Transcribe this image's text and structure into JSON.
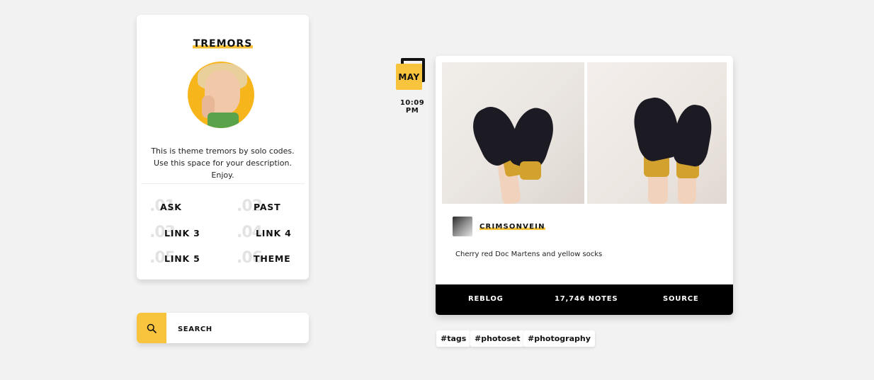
{
  "sidebar": {
    "blog_title": "TREMORS",
    "description": "This is theme tremors by solo codes. Use this space for your description. Enjoy.",
    "links": [
      {
        "num": ".01",
        "label": "ASK"
      },
      {
        "num": ".02",
        "label": "PAST"
      },
      {
        "num": ".03",
        "label": "LINK 3"
      },
      {
        "num": ".04",
        "label": "LINK 4"
      },
      {
        "num": ".05",
        "label": "LINK 5"
      },
      {
        "num": ".06",
        "label": "THEME"
      }
    ]
  },
  "search": {
    "placeholder": "SEARCH",
    "icon": "search-icon"
  },
  "post": {
    "month": "MAY",
    "time": "10:09 PM",
    "poster_name": "CRIMSONVEIN",
    "caption": "Cherry red Doc Martens and yellow socks",
    "footer": {
      "reblog": "REBLOG",
      "notes": "17,746 NOTES",
      "source": "SOURCE"
    },
    "tags": [
      "#tags",
      "#photoset",
      "#photography"
    ]
  },
  "colors": {
    "accent": "#f9c43d",
    "background": "#f2f2f2",
    "footer": "#000000"
  }
}
